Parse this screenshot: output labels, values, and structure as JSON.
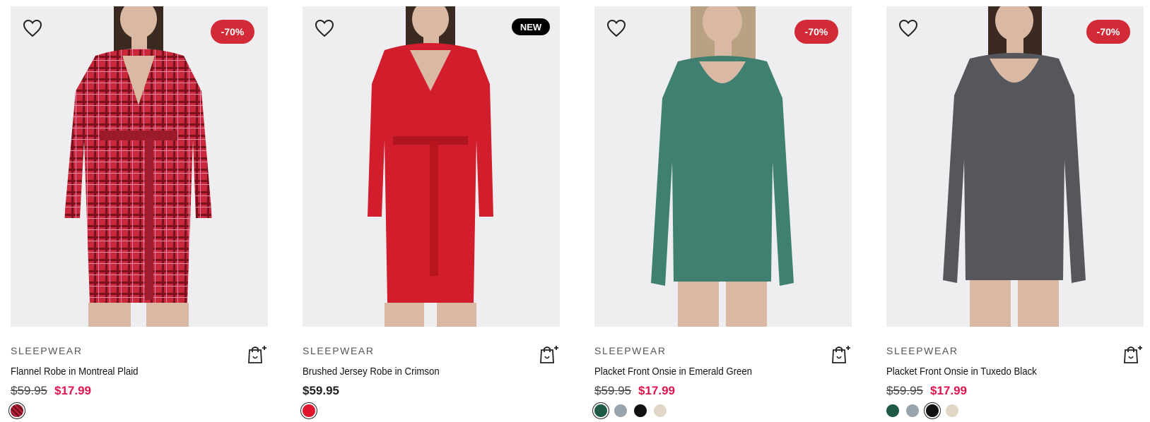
{
  "products": [
    {
      "category": "SLEEPWEAR",
      "title": "Flannel Robe in Montreal Plaid",
      "price_old": "$59.95",
      "price": "$17.99",
      "badge": "-70%",
      "badge_type": "discount",
      "swatches": [
        {
          "name": "plaid",
          "color": "#b3223a",
          "selected": true
        }
      ],
      "image_color": "#c8283a"
    },
    {
      "category": "SLEEPWEAR",
      "title": "Brushed Jersey Robe in Crimson",
      "price_old": "",
      "price": "$59.95",
      "badge": "NEW",
      "badge_type": "new",
      "swatches": [
        {
          "name": "crimson",
          "color": "#e0142c",
          "selected": true
        }
      ],
      "image_color": "#d21e2c"
    },
    {
      "category": "SLEEPWEAR",
      "title": "Placket Front Onsie in Emerald Green",
      "price_old": "$59.95",
      "price": "$17.99",
      "badge": "-70%",
      "badge_type": "discount",
      "swatches": [
        {
          "name": "emerald",
          "color": "#1f5a44",
          "selected": true
        },
        {
          "name": "grey-blue",
          "color": "#9aa4ae",
          "selected": false
        },
        {
          "name": "black",
          "color": "#111111",
          "selected": false
        },
        {
          "name": "oatmeal",
          "color": "#e2d6c6",
          "selected": false
        }
      ],
      "image_color": "#3f8070"
    },
    {
      "category": "SLEEPWEAR",
      "title": "Placket Front Onsie in Tuxedo Black",
      "price_old": "$59.95",
      "price": "$17.99",
      "badge": "-70%",
      "badge_type": "discount",
      "swatches": [
        {
          "name": "emerald",
          "color": "#1f5a44",
          "selected": false
        },
        {
          "name": "grey-blue",
          "color": "#9aa4ae",
          "selected": false
        },
        {
          "name": "black",
          "color": "#111111",
          "selected": true
        },
        {
          "name": "oatmeal",
          "color": "#e2d6c6",
          "selected": false
        }
      ],
      "image_color": "#55575c"
    }
  ],
  "icons": {
    "wishlist": "heart-outline-icon",
    "add_to_bag": "shopping-bag-plus-icon"
  }
}
